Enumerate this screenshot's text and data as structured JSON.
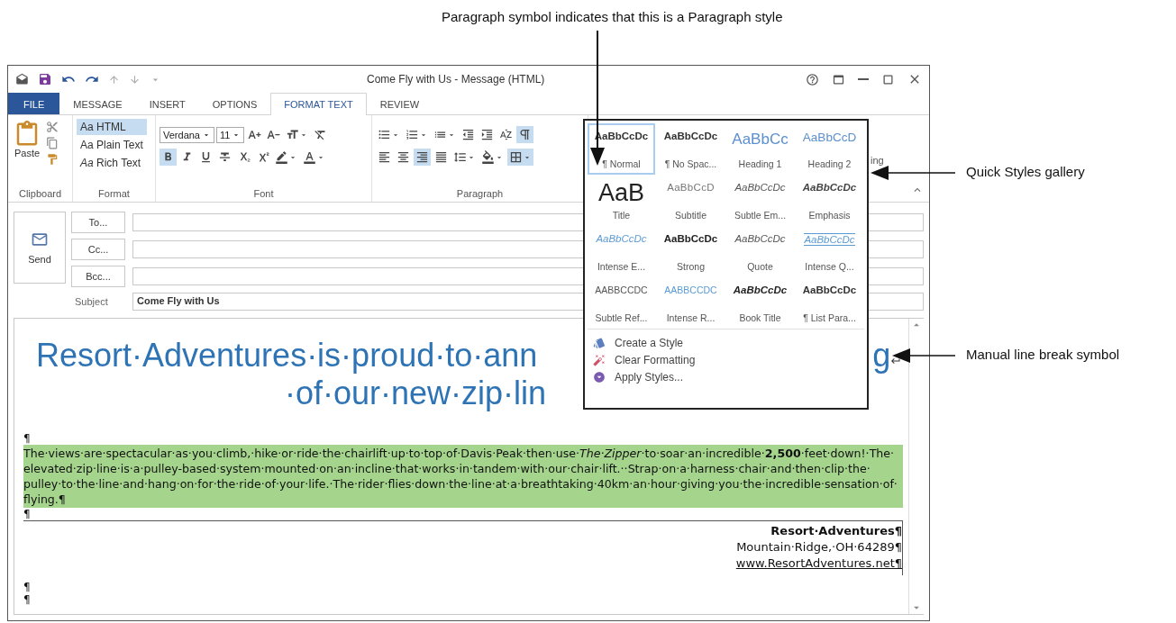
{
  "callouts": [
    "Paragraph symbol indicates that this is a Paragraph style",
    "Quick Styles gallery",
    "Manual line break symbol"
  ],
  "window": {
    "title": "Come Fly with Us - Message (HTML)"
  },
  "tabs": [
    {
      "label": "FILE",
      "kind": "file",
      "selected": false
    },
    {
      "label": "MESSAGE",
      "kind": "tab",
      "selected": false
    },
    {
      "label": "INSERT",
      "kind": "tab",
      "selected": false
    },
    {
      "label": "OPTIONS",
      "kind": "tab",
      "selected": false
    },
    {
      "label": "FORMAT TEXT",
      "kind": "tab",
      "selected": true
    },
    {
      "label": "REVIEW",
      "kind": "tab",
      "selected": false
    }
  ],
  "ribbon": {
    "clipboard": {
      "paste": "Paste",
      "label": "Clipboard"
    },
    "format": {
      "label": "Format",
      "options": [
        {
          "label": "Aa HTML",
          "selected": true
        },
        {
          "label": "Aa Plain Text",
          "selected": false
        },
        {
          "label": "*Aa* Rich Text",
          "selected": false
        }
      ]
    },
    "font": {
      "label": "Font",
      "family": "Verdana",
      "size": "11",
      "row1": [
        {
          "kind": "grow",
          "on": false
        },
        {
          "kind": "shrink",
          "on": false
        },
        {
          "kind": "case",
          "on": false
        },
        {
          "kind": "clear",
          "on": false
        }
      ],
      "row2": [
        {
          "kind": "bold",
          "on": true
        },
        {
          "kind": "italic",
          "on": false
        },
        {
          "kind": "underline",
          "on": false
        },
        {
          "kind": "strike",
          "on": false
        },
        {
          "kind": "subscript",
          "on": false
        },
        {
          "kind": "superscript",
          "on": false
        },
        {
          "kind": "highlight",
          "on": false
        },
        {
          "kind": "fontcolor",
          "on": false
        }
      ]
    },
    "paragraph": {
      "label": "Paragraph",
      "row1": [
        {
          "kind": "bullets",
          "on": false
        },
        {
          "kind": "numbering",
          "on": false
        },
        {
          "kind": "multilevel",
          "on": false
        },
        {
          "kind": "outdent",
          "on": false
        },
        {
          "kind": "indent",
          "on": false
        },
        {
          "kind": "sort",
          "on": false
        },
        {
          "kind": "marks",
          "on": true
        }
      ],
      "row2": [
        {
          "kind": "alignleft",
          "on": false
        },
        {
          "kind": "center",
          "on": false
        },
        {
          "kind": "alignright",
          "on": true
        },
        {
          "kind": "justify",
          "on": false
        },
        {
          "kind": "spacing",
          "on": false
        },
        {
          "kind": "shading",
          "on": false
        },
        {
          "kind": "borders",
          "on": true
        }
      ]
    },
    "cut_label": "ing"
  },
  "message": {
    "send": "Send",
    "fields": [
      {
        "kind": "button",
        "label": "To..."
      },
      {
        "kind": "button",
        "label": "Cc..."
      },
      {
        "kind": "button",
        "label": "Bcc..."
      },
      {
        "kind": "label",
        "label": "Subject",
        "value": "Come Fly with Us"
      }
    ]
  },
  "body": {
    "heading_left": "Resort·Adventures·is·proud·to·ann",
    "heading_right": "g",
    "heading_line2": "·of·our·new·zip·lin",
    "mark_before": "¶",
    "paragraph": "The·views·are·spectacular·as·you·climb,·hike·or·ride·the·chairlift·up·to·top·of·Davis·Peak·then·use·*The·Zipper*·to·soar·an·incredible·**2,500**·feet·down!·The·elevated·zip·line·is·a·pulley-based·system·mounted·on·an·incline·that·works·in·tandem·with·our·chair·lift.··Strap·on·a·harness·chair·and·then·clip·the·pulley·to·the·line·and·hang·on·for·the·ride·of·your·life.·The·rider·flies·down·the·line·at·a·breathtaking·40km·an·hour·giving·you·the·incredible·sensation·of·flying.¶",
    "mark_after": "¶",
    "signature": {
      "name": "Resort·Adventures¶",
      "address": "Mountain·Ridge,·OH·64289¶",
      "link": "www.ResortAdventures.net¶"
    },
    "trailing_marks": [
      "¶",
      "¶"
    ]
  },
  "styles_gallery": {
    "items": [
      {
        "preview": "AaBbCcDc",
        "name": "¶ Normal",
        "kind": "normal",
        "selected": true
      },
      {
        "preview": "AaBbCcDc",
        "name": "¶ No Spac...",
        "kind": "normal",
        "selected": false
      },
      {
        "preview": "AaBbCc",
        "name": "Heading 1",
        "kind": "heading1",
        "selected": false
      },
      {
        "preview": "AaBbCcD",
        "name": "Heading 2",
        "kind": "heading2",
        "selected": false
      },
      {
        "preview": "AaB",
        "name": "Title",
        "kind": "title",
        "selected": false
      },
      {
        "preview": "AaBbCcD",
        "name": "Subtitle",
        "kind": "subtitle",
        "selected": false
      },
      {
        "preview": "AaBbCcDc",
        "name": "Subtle Em...",
        "kind": "subtle",
        "selected": false
      },
      {
        "preview": "AaBbCcDc",
        "name": "Emphasis",
        "kind": "emphasis",
        "selected": false
      },
      {
        "preview": "AaBbCcDc",
        "name": "Intense E...",
        "kind": "intense",
        "selected": false
      },
      {
        "preview": "AaBbCcDc",
        "name": "Strong",
        "kind": "strong",
        "selected": false
      },
      {
        "preview": "AaBbCcDc",
        "name": "Quote",
        "kind": "subtle",
        "selected": false
      },
      {
        "preview": "AaBbCcDc",
        "name": "Intense Q...",
        "kind": "intensequote",
        "selected": false
      },
      {
        "preview": "AABBCCDC",
        "name": "Subtle Ref...",
        "kind": "reference",
        "selected": false
      },
      {
        "preview": "AABBCCDC",
        "name": "Intense R...",
        "kind": "intenseref",
        "selected": false
      },
      {
        "preview": "AaBbCcDc",
        "name": "Book Title",
        "kind": "booktitle",
        "selected": false
      },
      {
        "preview": "AaBbCcDc",
        "name": "¶ List Para...",
        "kind": "normal",
        "selected": false
      }
    ],
    "commands": [
      {
        "kind": "create",
        "label": "Create a Style"
      },
      {
        "kind": "clear",
        "label": "Clear Formatting"
      },
      {
        "kind": "apply",
        "label": "Apply Styles..."
      }
    ]
  }
}
